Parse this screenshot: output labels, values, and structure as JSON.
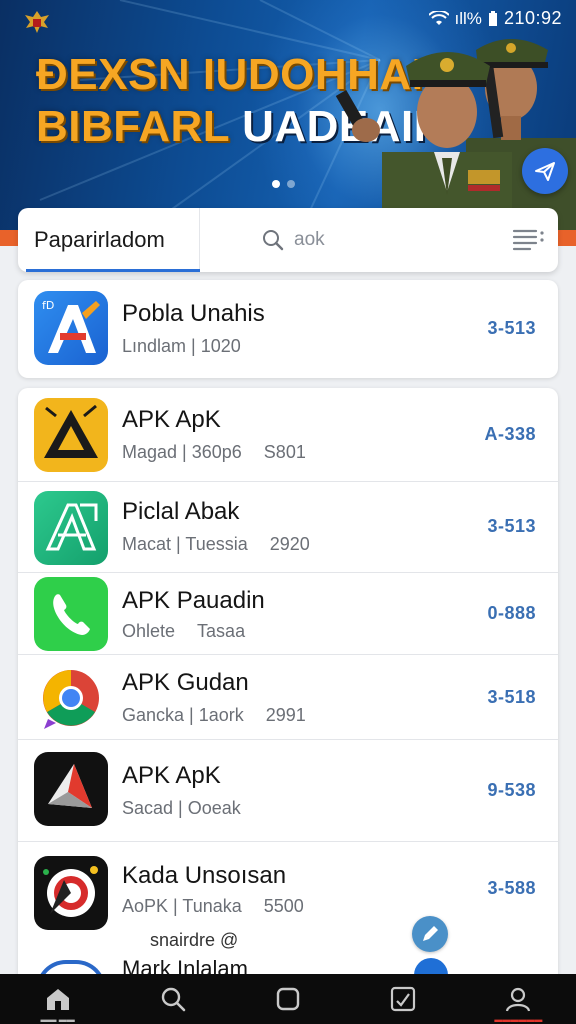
{
  "status_bar": {
    "time": "210:92",
    "battery_text": "ıll%"
  },
  "banner": {
    "headline_line1": "ÐEXSN IUDOHHAMI",
    "headline_line2_orange": "BIBFARL ",
    "headline_line2_white": "UADEAII:"
  },
  "tabs": {
    "active_label": "Paparirladom"
  },
  "search": {
    "placeholder": "aok"
  },
  "apps": [
    {
      "name": "Pobla Unahis",
      "meta": [
        "Lındlam",
        "1020"
      ],
      "number": "3-513",
      "icon": "a-pen-icon"
    },
    {
      "name": "APK ApK",
      "meta": [
        "Magad",
        "360p6",
        "S801"
      ],
      "number": "A-338",
      "icon": "warning-triangle-icon"
    },
    {
      "name": "Piclal Abak",
      "meta": [
        "Macat",
        "Tuessia",
        "2920"
      ],
      "number": "3-513",
      "icon": "a-frame-icon"
    },
    {
      "name": "APK Pauadin",
      "meta": [
        "Ohlete",
        "Tasaa"
      ],
      "number": "0-888",
      "icon": "phone-icon"
    },
    {
      "name": "APK Gudan",
      "meta": [
        "Gancka",
        "1aork",
        "2991"
      ],
      "number": "3-518",
      "icon": "chrome-icon"
    },
    {
      "name": "APK ApK",
      "meta": [
        "Sacad",
        "Ooeak"
      ],
      "number": "9-538",
      "icon": "shard-icon"
    },
    {
      "name": "Kada Unsoısan",
      "meta": [
        "AoPK",
        "Tunaka",
        "5500"
      ],
      "number": "3-588",
      "icon": "target-icon"
    }
  ],
  "floating_label": "snairdre @",
  "partial_item_name": "Mark Inlalam",
  "colors": {
    "accent": "#2b6fd6",
    "orange": "#e8622a",
    "banner": "#0d4c93"
  }
}
